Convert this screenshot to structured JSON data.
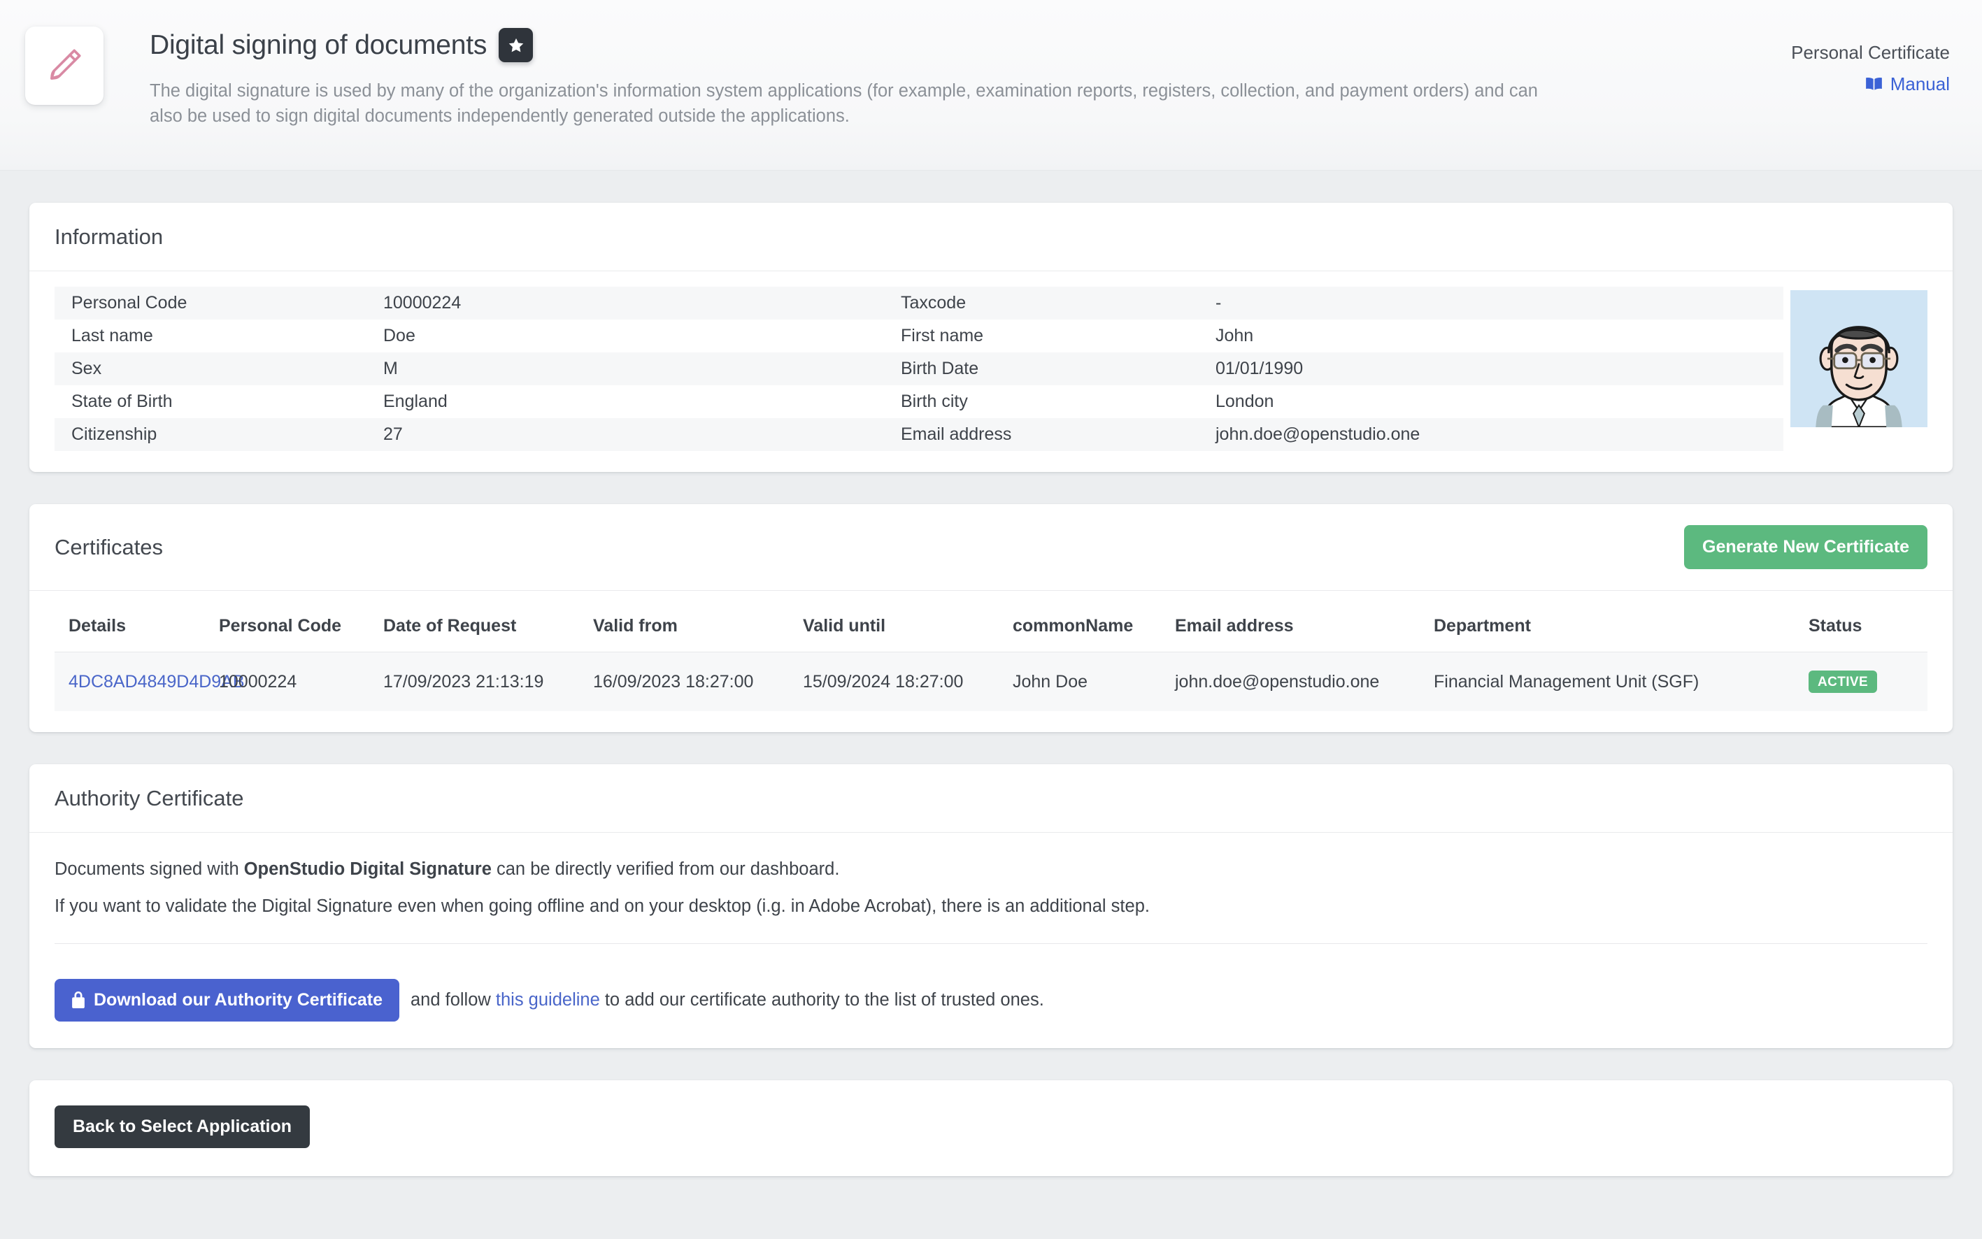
{
  "header": {
    "app_icon": "pen-icon",
    "title": "Digital signing of documents",
    "favorite_icon": "star-icon",
    "description": "The digital signature is used by many of the organization's information system applications (for example, examination reports, registers, collection, and payment orders) and can also be used to sign digital documents independently generated outside the applications.",
    "right_label": "Personal Certificate",
    "manual_link": "Manual",
    "manual_icon": "open-book-icon",
    "link_color": "#3b62d6"
  },
  "information": {
    "title": "Information",
    "rows": [
      {
        "key_left": "Personal Code",
        "value_left": "10000224",
        "key_right": "Taxcode",
        "value_right": "-"
      },
      {
        "key_left": "Last name",
        "value_left": "Doe",
        "key_right": "First name",
        "value_right": "John"
      },
      {
        "key_left": "Sex",
        "value_left": "M",
        "key_right": "Birth Date",
        "value_right": "01/01/1990"
      },
      {
        "key_left": "State of Birth",
        "value_left": "England",
        "key_right": "Birth city",
        "value_right": "London"
      },
      {
        "key_left": "Citizenship",
        "value_left": "27",
        "key_right": "Email address",
        "value_right": "john.doe@openstudio.one"
      }
    ],
    "avatar": "user-avatar"
  },
  "certificates": {
    "title": "Certificates",
    "generate_button": "Generate New Certificate",
    "generate_button_color": "#5cb97f",
    "columns": [
      "Details",
      "Personal Code",
      "Date of Request",
      "Valid from",
      "Valid until",
      "commonName",
      "Email address",
      "Department",
      "Status"
    ],
    "rows": [
      {
        "details": "4DC8AD4849D4D9AB",
        "personal_code": "10000224",
        "date_of_request": "17/09/2023 21:13:19",
        "valid_from": "16/09/2023 18:27:00",
        "valid_until": "15/09/2024 18:27:00",
        "common_name": "John Doe",
        "email": "john.doe@openstudio.one",
        "department": "Financial Management Unit (SGF)",
        "status": "ACTIVE",
        "status_color": "#5cb97f"
      }
    ]
  },
  "authority": {
    "title": "Authority Certificate",
    "line1_before": "Documents signed with ",
    "line1_bold": "OpenStudio Digital Signature",
    "line1_after": " can be directly verified from our dashboard.",
    "line2": "If you want to validate the Digital Signature even when going offline and on your desktop (i.g. in Adobe Acrobat), there is an additional step.",
    "download_button": "Download our Authority Certificate",
    "download_icon": "lock-icon",
    "download_button_color": "#4a62cf",
    "follow_before": "and follow ",
    "follow_link": "this guideline",
    "follow_after": " to add our certificate authority to the list of trusted ones."
  },
  "footer": {
    "back_button": "Back to Select Application",
    "back_button_color": "#343a40"
  }
}
